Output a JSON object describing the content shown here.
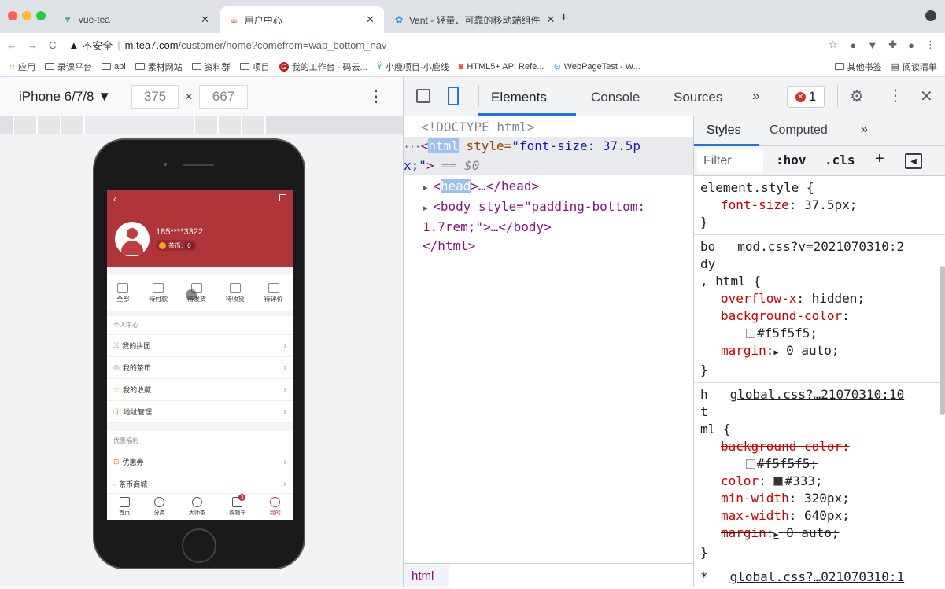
{
  "browser": {
    "tabs": [
      {
        "title": "vue-tea",
        "icon": "vue-logo-icon",
        "active": false
      },
      {
        "title": "用户中心",
        "icon": "tea-logo-icon",
        "active": true
      },
      {
        "title": "Vant - 轻量、可靠的移动端组件 ",
        "icon": "vant-logo-icon",
        "active": false
      }
    ],
    "new_tab": "+",
    "address": {
      "insecure_label": "不安全",
      "host": "m.tea7.com",
      "path": "/customer/home?comefrom=wap_bottom_nav"
    },
    "bookmarks": [
      "应用",
      "录课平台",
      "api",
      "素材网站",
      "资料群",
      "项目",
      "我的工作台 - 码云...",
      "小鹿项目-小鹿线",
      "HTML5+ API Refe...",
      "WebPageTest - W..."
    ],
    "bookmarks_right": [
      "其他书签",
      "阅读清单"
    ]
  },
  "device": {
    "name": "iPhone 6/7/8 ▼",
    "width": "375",
    "height": "667",
    "times": "×"
  },
  "mobile": {
    "phone": "185****3322",
    "coin_label": "茶币:",
    "coin_value": "0",
    "orders": [
      "全部",
      "待付款",
      "待发货",
      "待收货",
      "待评价"
    ],
    "section1": "个人中心",
    "menu1": [
      "我的拼团",
      "我的茶币",
      "我的收藏",
      "地址管理"
    ],
    "section2": "优惠福利",
    "menu2": [
      "优惠券",
      "茶币商城"
    ],
    "nav": [
      "首页",
      "分类",
      "大师茶",
      "购物车",
      "我的"
    ],
    "cart_badge": "3",
    "colors": {
      "header": "#b0353a",
      "active": "#b0353a"
    }
  },
  "devtools": {
    "tabs": [
      "Elements",
      "Console",
      "Sources"
    ],
    "more": "»",
    "error_count": "1",
    "dom": {
      "doctype": "<!DOCTYPE html>",
      "html_open_1": "<",
      "html_tag": "html",
      "html_attr": " style=",
      "html_attr_val_1": "\"font-size: 37.5p",
      "html_attr_val_2": "x;\"",
      "html_close_1": ">",
      "eq": " == $0",
      "head": "head",
      "head_rest": ">…</head>",
      "body_line1": "<body style=\"padding-bottom:",
      "body_line2": "1.7rem;\">…</body>",
      "html_end": "</html>",
      "ellipsis": "···"
    },
    "breadcrumb": "html",
    "styles": {
      "tabs": [
        "Styles",
        "Computed"
      ],
      "more": "»",
      "filter": "Filter",
      "hov": ":hov",
      "cls": ".cls",
      "plus": "+",
      "rule1_selector": "element.style {",
      "rule1_prop": "font-size",
      "rule1_val": "37.5px;",
      "rule2_sel_a": "bo",
      "rule2_sel_b": "dy",
      "rule2_sel_c": ", html {",
      "rule2_link": "mod.css?v=2021070310:2",
      "rule2_props": [
        [
          "overflow-x",
          "hidden;"
        ],
        [
          "background-color",
          ""
        ],
        [
          "",
          "#f5f5f5;"
        ],
        [
          "margin",
          "0 auto;"
        ]
      ],
      "rule3_sel_a": "h",
      "rule3_sel_b": "t",
      "rule3_sel_c": "ml {",
      "rule3_link": "global.css?…21070310:10",
      "rule3_bg_prop": "background-color:",
      "rule3_bg_val": "#f5f5f5;",
      "rule3_color_prop": "color",
      "rule3_color_val": "#333;",
      "rule3_minw_prop": "min-width",
      "rule3_minw_val": "320px;",
      "rule3_maxw_prop": "max-width",
      "rule3_maxw_val": "640px;",
      "rule3_margin": "margin:",
      "rule3_margin_val": "0 auto;",
      "close": "}",
      "rule4_sel": "*",
      "rule4_link": "global.css?…021070310:1"
    }
  }
}
